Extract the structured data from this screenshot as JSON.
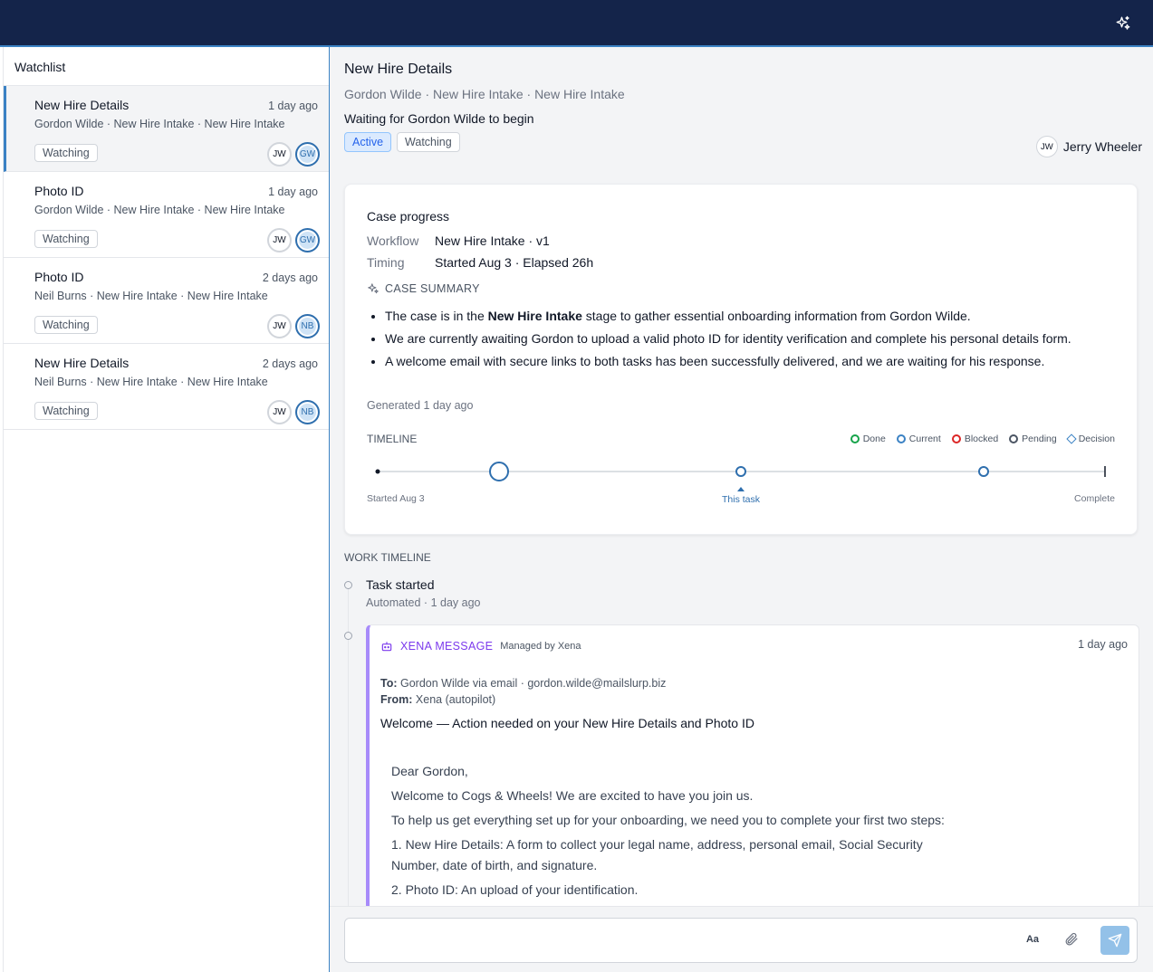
{
  "topbar": {
    "assistant_icon": "sparkle-icon"
  },
  "sidebar": {
    "title": "Watchlist",
    "items": [
      {
        "title": "New Hire Details",
        "time": "1 day ago",
        "subtitle": "Gordon Wilde · New Hire Intake · New Hire Intake",
        "badge": "Watching",
        "avatar1": "JW",
        "avatar2": "GW"
      },
      {
        "title": "Photo ID",
        "time": "1 day ago",
        "subtitle": "Gordon Wilde · New Hire Intake · New Hire Intake",
        "badge": "Watching",
        "avatar1": "JW",
        "avatar2": "GW"
      },
      {
        "title": "Photo ID",
        "time": "2 days ago",
        "subtitle": "Neil Burns · New Hire Intake · New Hire Intake",
        "badge": "Watching",
        "avatar1": "JW",
        "avatar2": "NB"
      },
      {
        "title": "New Hire Details",
        "time": "2 days ago",
        "subtitle": "Neil Burns · New Hire Intake · New Hire Intake",
        "badge": "Watching",
        "avatar1": "JW",
        "avatar2": "NB"
      }
    ]
  },
  "main": {
    "title": "New Hire Details",
    "subtitle": "Gordon Wilde · New Hire Intake · New Hire Intake",
    "status": "Waiting for Gordon Wilde to begin",
    "badges": {
      "active": "Active",
      "watching": "Watching"
    },
    "assignee": {
      "initials": "JW",
      "name": "Jerry Wheeler"
    }
  },
  "case_progress": {
    "title": "Case progress",
    "workflow_label": "Workflow",
    "workflow_value": "New Hire Intake · v1",
    "timing_label": "Timing",
    "timing_value": "Started Aug 3 · Elapsed 26h",
    "summary_heading": "CASE SUMMARY",
    "summary": {
      "b1_pre": "The case is in the ",
      "b1_bold": "New Hire Intake",
      "b1_post": " stage to gather essential onboarding information from Gordon Wilde.",
      "b2": "We are currently awaiting Gordon to upload a valid photo ID for identity verification and complete his personal details form.",
      "b3": "A welcome email with secure links to both tasks has been successfully delivered, and we are waiting for his response."
    },
    "generated": "Generated 1 day ago",
    "timeline": {
      "label": "TIMELINE",
      "legend": {
        "done": "Done",
        "current": "Current",
        "blocked": "Blocked",
        "pending": "Pending",
        "decision": "Decision"
      },
      "start_label": "Started Aug 3",
      "this_task_label": "This task",
      "end_label": "Complete"
    }
  },
  "work_timeline": {
    "label": "WORK TIMELINE",
    "task_started": {
      "title": "Task started",
      "sub": "Automated · 1 day ago"
    },
    "message": {
      "kind": "XENA MESSAGE",
      "managed": "Managed by Xena",
      "time": "1 day ago",
      "to_label": "To:",
      "to_value": "Gordon Wilde via email · gordon.wilde@mailslurp.biz",
      "from_label": "From:",
      "from_value": "Xena (autopilot)",
      "subject": "Welcome — Action needed on your New Hire Details and Photo ID",
      "body": {
        "greeting": "Dear Gordon,",
        "p1": "Welcome to Cogs & Wheels! We are excited to have you join us.",
        "p2": "To help us get everything set up for your onboarding, we need you to complete your first two steps:",
        "l1": "1. New Hire Details: A form to collect your legal name, address, personal email, Social Security Number, date of birth, and signature.",
        "l2": "2. Photo ID: An upload of your identification."
      }
    }
  },
  "composer": {
    "placeholder": "",
    "format_label": "Aa"
  },
  "colors": {
    "navy": "#14244a",
    "accent": "#3b82c4",
    "purple": "#7c3aed",
    "done": "#16a34a",
    "blocked": "#dc2626"
  }
}
